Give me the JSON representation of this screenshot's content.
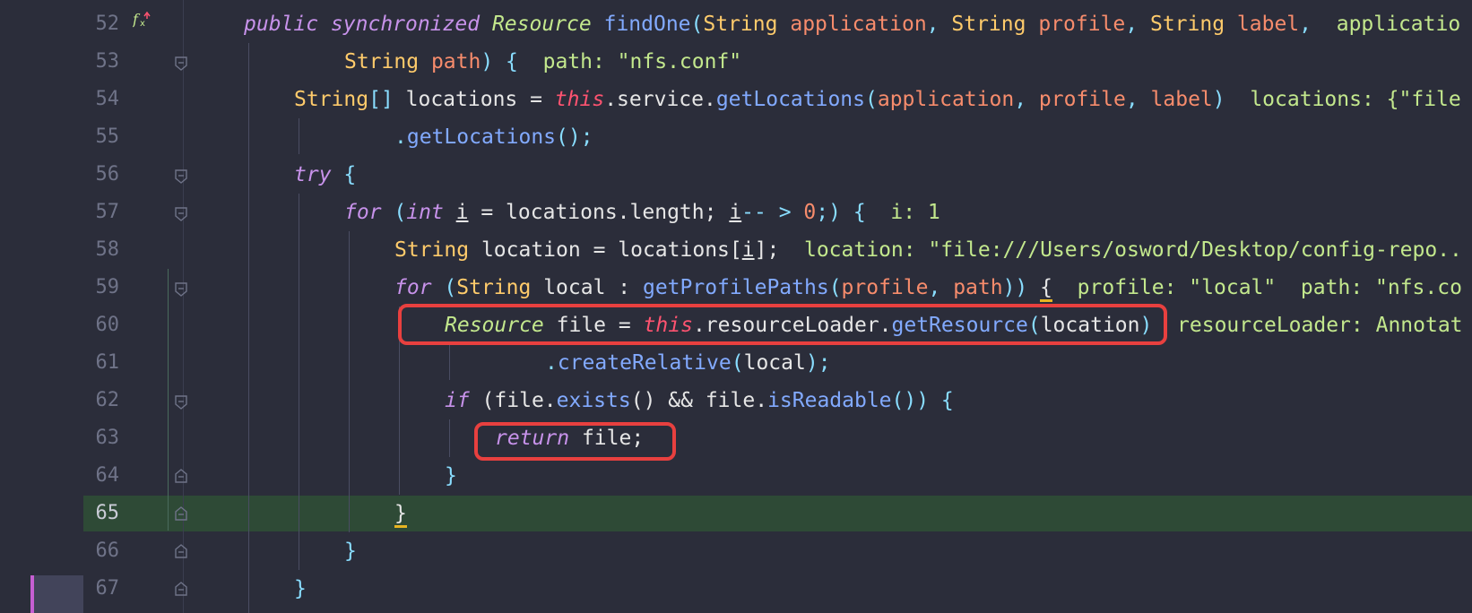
{
  "colors": {
    "background": "#2b2d3a",
    "current_line": "#2e4a36",
    "annotation_red": "#e8403f",
    "bookmark_purple": "#c65fd2"
  },
  "icons": {
    "fx": "function-breakpoint-icon",
    "fold": "fold-marker-icon"
  },
  "current_line_number": "65",
  "line_numbers": [
    "52",
    "53",
    "54",
    "55",
    "56",
    "57",
    "58",
    "59",
    "60",
    "61",
    "62",
    "63",
    "64",
    "65",
    "66",
    "67"
  ],
  "code": {
    "l52": {
      "t1": "public synchronized ",
      "t2": "Resource",
      "t3": " ",
      "t4": "findOne",
      "t5": "(",
      "t6": "String",
      "t7": " ",
      "t8": "application",
      "t9": ", ",
      "t10": "String",
      "t11": " ",
      "t12": "profile",
      "t13": ", ",
      "t14": "String",
      "t15": " ",
      "t16": "label",
      "t17": ",  ",
      "t18": "applicatio"
    },
    "l53": {
      "t1": "String",
      "t2": " ",
      "t3": "path",
      "t4": ") {  ",
      "t5": "path: \"nfs.conf\""
    },
    "l54": {
      "t1": "String",
      "t2": "[] ",
      "t3": "locations = ",
      "t4": "this",
      "t5": ".service.",
      "t6": "getLocations",
      "t7": "(",
      "t8": "application",
      "t9": ", ",
      "t10": "profile",
      "t11": ", ",
      "t12": "label",
      "t13": ")  ",
      "t14": "locations: {\"file"
    },
    "l55": {
      "t1": ".",
      "t2": "getLocations",
      "t3": "();"
    },
    "l56": {
      "t1": "try",
      "t2": " {"
    },
    "l57": {
      "t1": "for",
      "t2": " (",
      "t3": "int",
      "t4": " ",
      "t5": "i",
      "t6": " = locations.length; ",
      "t7": "i",
      "t8": "-- > ",
      "t9": "0",
      "t10": ";) {  ",
      "t11": "i: 1"
    },
    "l58": {
      "t1": "String",
      "t2": " location = locations[",
      "t3": "i",
      "t4": "];  ",
      "t5": "location: \"file:///Users/osword/Desktop/config-repo.."
    },
    "l59": {
      "t1": "for",
      "t2": " (",
      "t3": "String",
      "t4": " local : ",
      "t5": "getProfilePaths",
      "t6": "(",
      "t7": "profile",
      "t8": ", ",
      "t9": "path",
      "t10": ")) ",
      "t11": "{",
      "t12": "  profile: \"local\"  path: \"nfs.co"
    },
    "l60": {
      "t1": "Resource",
      "t2": " file = ",
      "t3": "this",
      "t4": ".resourceLoader.",
      "t5": "getResource",
      "t6": "(",
      "t7": "location",
      "t8": ")",
      "t9": "  resourceLoader: Annotat"
    },
    "l61": {
      "t1": ".",
      "t2": "createRelative",
      "t3": "(",
      "t4": "local",
      "t5": ");"
    },
    "l62": {
      "t1": "if",
      "t2": " (file.",
      "t3": "exists",
      "t4": "() && file.",
      "t5": "isReadable",
      "t6": "()) {"
    },
    "l63": {
      "t1": "return",
      "t2": " file;"
    },
    "l64": {
      "t1": "}"
    },
    "l65": {
      "t1": "}"
    },
    "l66": {
      "t1": "}"
    },
    "l67": {
      "t1": "}"
    }
  }
}
